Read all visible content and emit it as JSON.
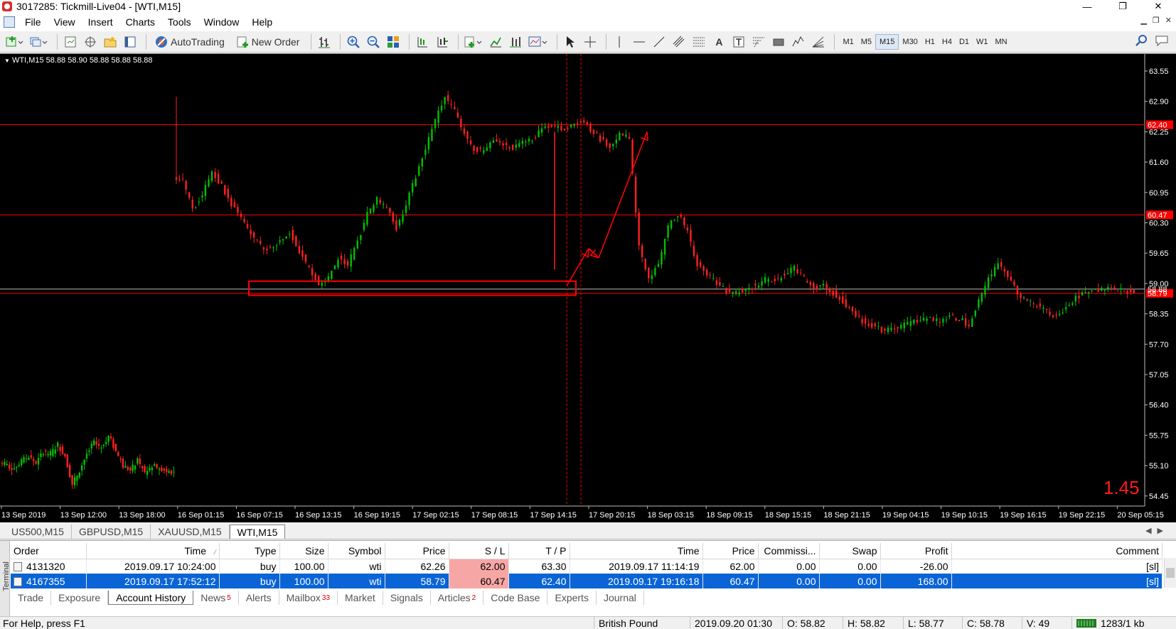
{
  "window": {
    "title": "3017285: Tickmill-Live04 - [WTI,M15]",
    "minimize": "—",
    "restore": "❐",
    "close": "✕"
  },
  "menu": [
    "File",
    "View",
    "Insert",
    "Charts",
    "Tools",
    "Window",
    "Help"
  ],
  "toolbar": {
    "autotrading_label": "AutoTrading",
    "new_order_label": "New Order",
    "text_tool": "A",
    "timeframes": [
      "M1",
      "M5",
      "M15",
      "M30",
      "H1",
      "H4",
      "D1",
      "W1",
      "MN"
    ],
    "active_timeframe": "M15"
  },
  "chart": {
    "header": "WTI,M15  58.88 58.90 58.88 58.88 58.88",
    "overlay_value": "1.45",
    "colors": {
      "bull": "#00c000",
      "bear": "#ff2020",
      "line": "#ff0000",
      "grid": "#ff0000"
    }
  },
  "chart_data": {
    "type": "candlestick",
    "symbol": "WTI",
    "timeframe": "M15",
    "y_ticks": [
      "63.55",
      "62.90",
      "62.25",
      "61.60",
      "60.95",
      "60.30",
      "59.65",
      "59.00",
      "58.35",
      "57.70",
      "57.05",
      "56.40",
      "55.75",
      "55.10",
      "54.45"
    ],
    "ylim": [
      54.3,
      63.8
    ],
    "x_ticks": [
      "13 Sep 2019",
      "13 Sep 12:00",
      "13 Sep 18:00",
      "16 Sep 01:15",
      "16 Sep 07:15",
      "16 Sep 13:15",
      "16 Sep 19:15",
      "17 Sep 02:15",
      "17 Sep 08:15",
      "17 Sep 14:15",
      "17 Sep 20:15",
      "18 Sep 03:15",
      "18 Sep 09:15",
      "18 Sep 15:15",
      "18 Sep 21:15",
      "19 Sep 04:15",
      "19 Sep 10:15",
      "19 Sep 16:15",
      "19 Sep 22:15",
      "20 Sep 05:15"
    ],
    "price_labels": [
      {
        "value": 62.4,
        "label": "62.40"
      },
      {
        "value": 60.47,
        "label": "60.47"
      },
      {
        "value": 58.79,
        "label": "58.79"
      },
      {
        "value": 58.88,
        "label": "58.88"
      }
    ],
    "series": [
      {
        "segment": "13 Sep",
        "closes": [
          55.1,
          55.05,
          55.2,
          55.3,
          55.15,
          55.4,
          55.35,
          55.55,
          55.3,
          54.7,
          55.0,
          55.35,
          55.6,
          55.5,
          55.75,
          55.4,
          55.1,
          55.0,
          55.2,
          54.95,
          55.1,
          55.05,
          55.0,
          54.95
        ]
      },
      {
        "segment": "16-20 Sep",
        "closes": [
          61.2,
          60.6,
          60.9,
          61.4,
          61.1,
          60.7,
          60.4,
          60.1,
          59.8,
          59.75,
          59.9,
          60.1,
          59.7,
          59.3,
          59.0,
          59.1,
          59.55,
          59.4,
          59.9,
          60.5,
          60.8,
          60.6,
          60.2,
          60.7,
          61.3,
          61.9,
          62.5,
          63.0,
          62.7,
          62.2,
          61.9,
          61.8,
          62.1,
          62.0,
          61.9,
          62.0,
          62.1,
          62.3,
          62.4,
          62.3,
          62.35,
          62.5,
          62.3,
          62.1,
          61.95,
          62.2,
          62.1,
          59.8,
          59.1,
          59.4,
          60.2,
          60.5,
          60.1,
          59.4,
          59.2,
          59.0,
          58.85,
          58.8,
          58.9,
          58.95,
          59.1,
          59.05,
          59.2,
          59.35,
          59.1,
          58.9,
          58.95,
          58.8,
          58.6,
          58.4,
          58.2,
          58.1,
          58.0,
          58.05,
          58.1,
          58.15,
          58.2,
          58.25,
          58.2,
          58.3,
          58.25,
          58.1,
          58.6,
          59.1,
          59.4,
          59.2,
          58.8,
          58.6,
          58.55,
          58.4,
          58.3,
          58.5,
          58.7,
          58.8,
          58.9,
          58.85,
          58.9,
          58.85,
          58.8
        ]
      }
    ]
  },
  "chart_tabs": [
    "US500,M15",
    "GBPUSD,M15",
    "XAUUSD,M15",
    "WTI,M15"
  ],
  "active_chart_tab": "WTI,M15",
  "terminal": {
    "side_label": "Terminal",
    "columns": [
      "Order",
      "Time",
      "Type",
      "Size",
      "Symbol",
      "Price",
      "S / L",
      "T / P",
      "Time",
      "Price",
      "Commissi...",
      "Swap",
      "Profit",
      "Comment"
    ],
    "rows": [
      [
        "4131320",
        "2019.09.17 10:24:00",
        "buy",
        "100.00",
        "wti",
        "62.26",
        "62.00",
        "63.30",
        "2019.09.17 11:14:19",
        "62.00",
        "0.00",
        "0.00",
        "-26.00",
        "[sl]"
      ],
      [
        "4167355",
        "2019.09.17 17:52:12",
        "buy",
        "100.00",
        "wti",
        "58.79",
        "60.47",
        "62.40",
        "2019.09.17 19:16:18",
        "60.47",
        "0.00",
        "0.00",
        "168.00",
        "[sl]"
      ]
    ],
    "tabs": [
      {
        "label": "Trade",
        "badge": ""
      },
      {
        "label": "Exposure",
        "badge": ""
      },
      {
        "label": "Account History",
        "badge": ""
      },
      {
        "label": "News",
        "badge": "5"
      },
      {
        "label": "Alerts",
        "badge": ""
      },
      {
        "label": "Mailbox",
        "badge": "33"
      },
      {
        "label": "Market",
        "badge": ""
      },
      {
        "label": "Signals",
        "badge": ""
      },
      {
        "label": "Articles",
        "badge": "2"
      },
      {
        "label": "Code Base",
        "badge": ""
      },
      {
        "label": "Experts",
        "badge": ""
      },
      {
        "label": "Journal",
        "badge": ""
      }
    ],
    "active_tab": "Account History"
  },
  "status": {
    "help": "For Help, press F1",
    "profile": "British Pound",
    "datetime": "2019.09.20 01:30",
    "open": "O: 58.82",
    "high": "H: 58.82",
    "low": "L: 58.77",
    "close": "C: 58.78",
    "volume": "V: 49",
    "traffic": "1283/1 kb"
  }
}
